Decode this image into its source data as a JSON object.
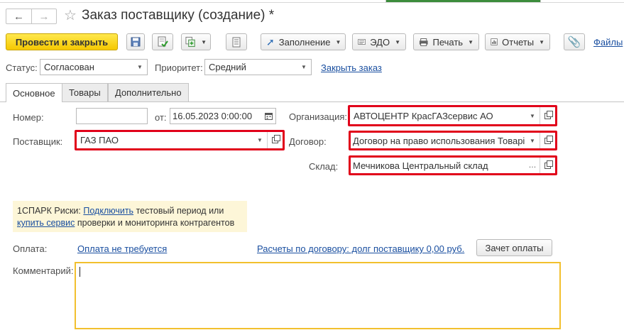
{
  "window": {
    "title": "Заказ поставщику (создание) *"
  },
  "toolbar": {
    "post_and_close": "Провести и закрыть",
    "fill": "Заполнение",
    "edo": "ЭДО",
    "print": "Печать",
    "reports": "Отчеты",
    "files": "Файлы"
  },
  "status_row": {
    "status_label": "Статус:",
    "status_value": "Согласован",
    "priority_label": "Приоритет:",
    "priority_value": "Средний",
    "close_order_link": "Закрыть заказ"
  },
  "tabs": [
    {
      "label": "Основное",
      "active": true
    },
    {
      "label": "Товары",
      "active": false
    },
    {
      "label": "Дополнительно",
      "active": false
    }
  ],
  "form": {
    "number_label": "Номер:",
    "number_value": "",
    "date_label": "от:",
    "date_value": "16.05.2023  0:00:00",
    "supplier_label": "Поставщик:",
    "supplier_value": "ГАЗ ПАО",
    "organization_label": "Организация:",
    "organization_value": "АВТОЦЕНТР КрасГАЗсервис АО",
    "contract_label": "Договор:",
    "contract_value": "Договор на право использования Товарі",
    "warehouse_label": "Склад:",
    "warehouse_value": "Мечникова Центральный склад"
  },
  "spark": {
    "prefix": "1СПАРК Риски:",
    "connect_link": "Подключить",
    "text1": "тестовый период или",
    "buy_link": "купить сервис",
    "text2": "проверки и мониторинга контрагентов"
  },
  "payment": {
    "label": "Оплата:",
    "not_required_link": "Оплата не требуется",
    "settlements_link": "Расчеты по договору: долг поставщику 0,00 руб.",
    "offset_button": "Зачет оплаты"
  },
  "comment": {
    "label": "Комментарий:",
    "value": ""
  },
  "colors": {
    "primary_button": "#f5c800",
    "highlight_border": "#e1001a",
    "link": "#1a4fa0",
    "comment_border": "#f2c02e"
  }
}
